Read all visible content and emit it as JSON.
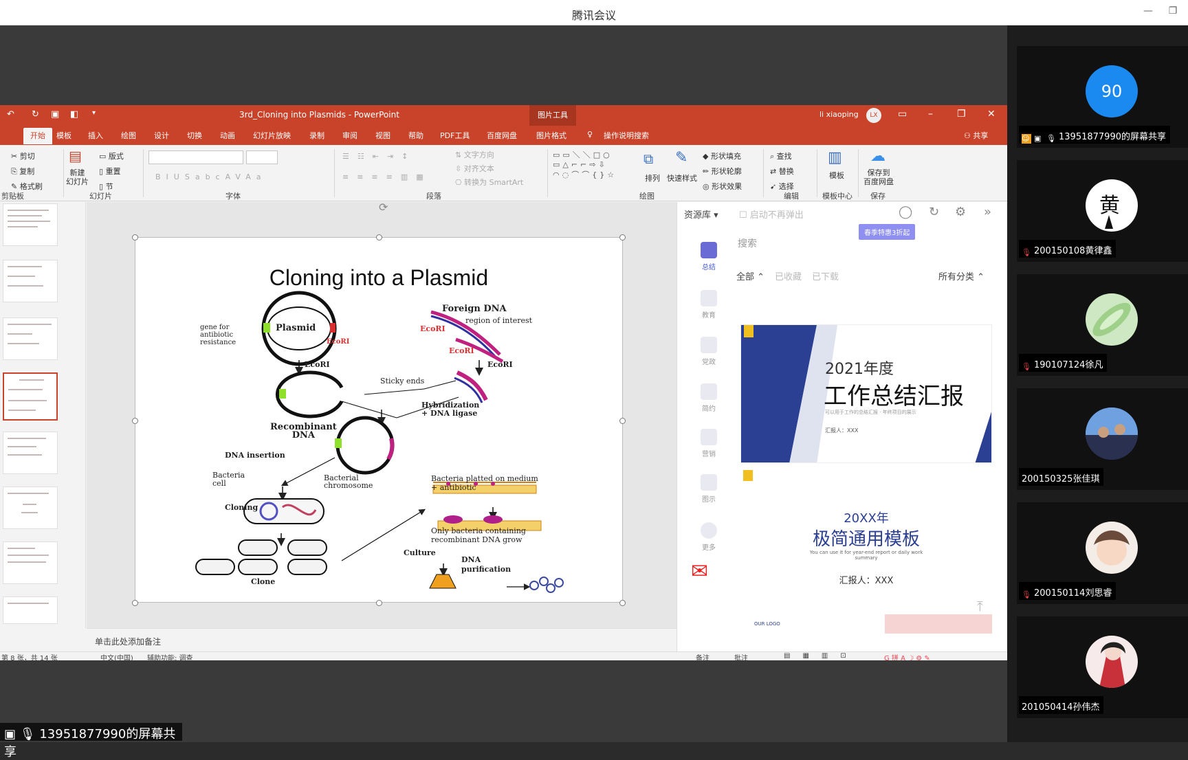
{
  "window": {
    "title": "腾讯会议"
  },
  "ppt": {
    "title": "3rd_Cloning into Plasmids - PowerPoint",
    "picture_tools": "图片工具",
    "user": "li xiaoping",
    "avatar_initials": "LX",
    "tabs": [
      "开始",
      "模板",
      "插入",
      "绘图",
      "设计",
      "切换",
      "动画",
      "幻灯片放映",
      "录制",
      "审阅",
      "视图",
      "帮助",
      "PDF工具",
      "百度网盘",
      "图片格式"
    ],
    "search_hint": "操作说明搜索",
    "share": "共享",
    "ribbon": {
      "cut": "剪切",
      "copy": "复制",
      "format_painter": "格式刷",
      "clipboard": "剪贴板",
      "new_slide": "新建\n幻灯片",
      "layout": "版式",
      "reset": "重置",
      "section": "节",
      "slides": "幻灯片",
      "font": "字体",
      "paragraph": "段落",
      "text_direction": "文字方向",
      "align_text": "对齐文本",
      "convert_smartart": "转换为 SmartArt",
      "drawing": "绘图",
      "arrange": "排列",
      "quick_styles": "快速样式",
      "shape_fill": "形状填充",
      "shape_outline": "形状轮廓",
      "shape_effects": "形状效果",
      "find": "查找",
      "replace": "替换",
      "select": "选择",
      "editing": "编辑",
      "templates": "模板",
      "template_center": "模板中心",
      "save_baidu": "保存到\n百度网盘",
      "save": "保存"
    },
    "slide": {
      "title": "Cloning into a Plasmid",
      "labels": {
        "gene_for": "gene for\nantibiotic\nresistance",
        "plasmid": "Plasmid",
        "ecori_1": "EcoRI",
        "foreign_dna": "Foreign DNA",
        "region": "region of interest",
        "ecori_2": "EcoRI",
        "ecori_3": "EcoRI",
        "ecori_4": "EcoRI",
        "ecori_5": "EcoRI",
        "sticky": "Sticky ends",
        "hybrid": "Hybridization\n+ DNA ligase",
        "recombinant": "Recombinant\nDNA",
        "insertion": "DNA insertion",
        "bacteria_cell": "Bacteria\ncell",
        "bact_chrom": "Bacterial\nchromosome",
        "platted": "Bacteria platted on medium\n+ antibiotic",
        "cloning": "Cloning",
        "clone": "Clone",
        "only": "Only bacteria containing\nrecombinant DNA grow",
        "culture": "Culture",
        "purification": "DNA\npurification"
      }
    },
    "notes": "单击此处添加备注",
    "status": {
      "slide": "第 8 张，共 14 张",
      "lang": "中文(中国)",
      "access": "辅助功能: 调查",
      "notes_btn": "备注",
      "comments_btn": "批注"
    }
  },
  "resources": {
    "dropdown": "资源库",
    "no_popup": "启动不再弹出",
    "promo": "春季特惠3折起",
    "search_placeholder": "搜索",
    "filter_all": "全部",
    "filter_fav": "已收藏",
    "filter_dl": "已下载",
    "categories": "所有分类",
    "side": [
      "总结",
      "教育",
      "党政",
      "简约",
      "营销",
      "图示",
      "更多"
    ],
    "card1": {
      "year": "2021年度",
      "title": "工作总结汇报",
      "sub": "可以用于工作的总结汇报 · 年终项目的展示",
      "reporter": "汇报人：XXX"
    },
    "card2": {
      "year": "20XX年",
      "title": "极简通用模板",
      "sub": "You can use it for year-end report or daily work summary",
      "reporter": "汇报人：XXX",
      "logo": "OUR LOGO"
    }
  },
  "meeting": {
    "share_status": "13951877990的屏幕共享",
    "participants": [
      {
        "name": "13951877990的屏幕共享",
        "badge": "90",
        "color": "#1b8af0"
      },
      {
        "name": "200150108黄律鑫"
      },
      {
        "name": "190107124徐凡"
      },
      {
        "name": "200150325张佳琪"
      },
      {
        "name": "200150114刘思睿"
      },
      {
        "name": "201050414孙伟杰"
      }
    ]
  }
}
